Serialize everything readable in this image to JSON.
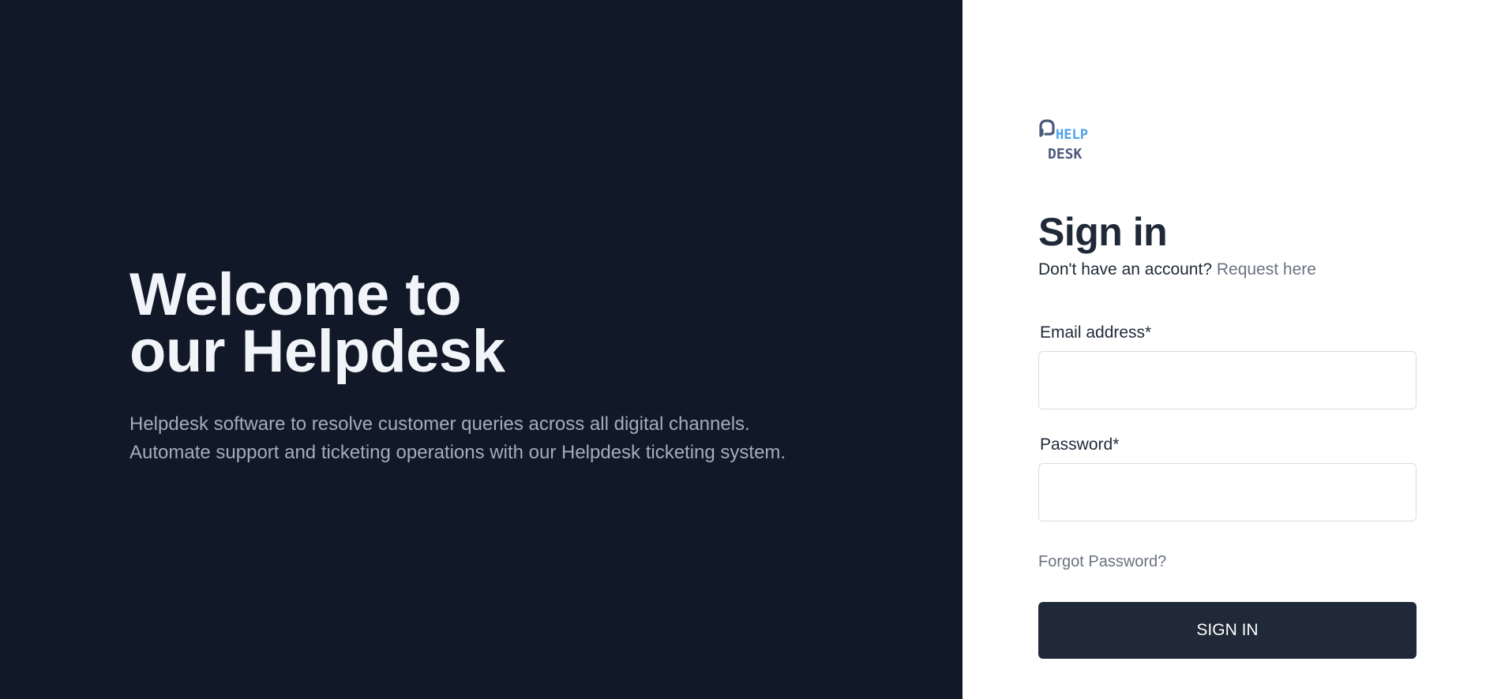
{
  "hero": {
    "title_line1": "Welcome to",
    "title_line2": "our Helpdesk",
    "subtitle_line1": "Helpdesk software to resolve customer queries across all digital channels.",
    "subtitle_line2": "Automate support and ticketing operations with our Helpdesk ticketing system."
  },
  "logo": {
    "line1": "HELP",
    "line2": "DESK",
    "icon": "headset-icon",
    "colors": {
      "accent": "#4ea3ea",
      "dark": "#4b5a7c"
    }
  },
  "signin": {
    "title": "Sign in",
    "no_account_text": "Don't have an account?",
    "request_link": "Request here",
    "email_label": "Email address*",
    "email_value": "",
    "password_label": "Password*",
    "password_value": "",
    "forgot_link": "Forgot Password?",
    "submit_label": "SIGN IN"
  },
  "colors": {
    "hero_bg": "#111827",
    "button_bg": "#1f2937",
    "muted_text": "#6b7280"
  }
}
